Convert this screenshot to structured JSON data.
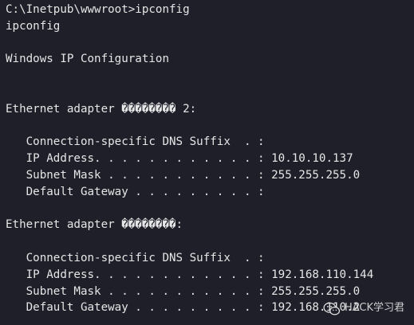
{
  "colors": {
    "background": "#1e1f29",
    "text": "#e6e6e6"
  },
  "terminal": {
    "lines": [
      "C:\\Inetpub\\wwwroot>ipconfig",
      "ipconfig",
      "",
      "Windows IP Configuration",
      "",
      "",
      "Ethernet adapter �������� 2:",
      "",
      "   Connection-specific DNS Suffix  . :",
      "   IP Address. . . . . . . . . . . . : 10.10.10.137",
      "   Subnet Mask . . . . . . . . . . . : 255.255.255.0",
      "   Default Gateway . . . . . . . . . :",
      "",
      "Ethernet adapter ��������:",
      "",
      "   Connection-specific DNS Suffix  . :",
      "   IP Address. . . . . . . . . . . . : 192.168.110.144",
      "   Subnet Mask . . . . . . . . . . . : 255.255.255.0",
      "   Default Gateway . . . . . . . . . : 192.168.110.2"
    ]
  },
  "watermark": {
    "text": "HACK学习君",
    "icon": "wechat-logo-icon"
  }
}
